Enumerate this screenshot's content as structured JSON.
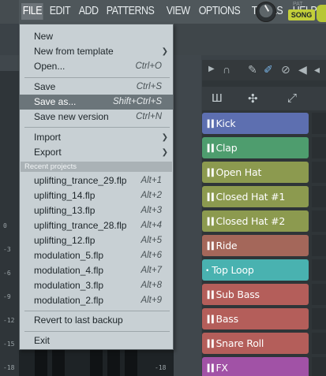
{
  "menubar": {
    "items": [
      "FILE",
      "EDIT",
      "ADD",
      "PATTERNS",
      "VIEW",
      "OPTIONS",
      "TOOLS",
      "HELP"
    ],
    "pattern_label": "PAT",
    "song_label": "SONG"
  },
  "file_menu": {
    "new": "New",
    "new_from_template": "New from template",
    "open": {
      "label": "Open...",
      "shortcut": "Ctrl+O"
    },
    "save": {
      "label": "Save",
      "shortcut": "Ctrl+S"
    },
    "save_as": {
      "label": "Save as...",
      "shortcut": "Shift+Ctrl+S"
    },
    "save_new_version": {
      "label": "Save new version",
      "shortcut": "Ctrl+N"
    },
    "import": "Import",
    "export": "Export",
    "recent_header": "Recent projects",
    "recent": [
      {
        "label": "uplifting_trance_29.flp",
        "shortcut": "Alt+1"
      },
      {
        "label": "uplifting_14.flp",
        "shortcut": "Alt+2"
      },
      {
        "label": "uplifting_13.flp",
        "shortcut": "Alt+3"
      },
      {
        "label": "uplifting_trance_28.flp",
        "shortcut": "Alt+4"
      },
      {
        "label": "uplifting_12.flp",
        "shortcut": "Alt+5"
      },
      {
        "label": "modulation_5.flp",
        "shortcut": "Alt+6"
      },
      {
        "label": "modulation_4.flp",
        "shortcut": "Alt+7"
      },
      {
        "label": "modulation_3.flp",
        "shortcut": "Alt+8"
      },
      {
        "label": "modulation_2.flp",
        "shortcut": "Alt+9"
      }
    ],
    "revert": "Revert to last backup",
    "exit": "Exit"
  },
  "mixer": {
    "db_labels": [
      "0",
      "-3",
      "-6",
      "-9",
      "-12",
      "-15",
      "-18"
    ],
    "db_right": "-18"
  },
  "channels": [
    {
      "name": "Kick",
      "color": "#5d6fb0",
      "mark": "▐▐"
    },
    {
      "name": "Clap",
      "color": "#4e9d6e",
      "mark": "▐▐"
    },
    {
      "name": "Open Hat",
      "color": "#8c9a4f",
      "mark": "▐▐"
    },
    {
      "name": "Closed Hat #1",
      "color": "#8c9a4f",
      "mark": "▐▐"
    },
    {
      "name": "Closed Hat #2",
      "color": "#8c9a4f",
      "mark": "▐▐"
    },
    {
      "name": "Ride",
      "color": "#a4675a",
      "mark": "▐▐"
    },
    {
      "name": "Top Loop",
      "color": "#49b2b0",
      "mark": "•"
    },
    {
      "name": "Sub Bass",
      "color": "#b45e5a",
      "mark": "▐▐"
    },
    {
      "name": "Bass",
      "color": "#b45e5a",
      "mark": "▐▐"
    },
    {
      "name": "Snare Roll",
      "color": "#b45e5a",
      "mark": "▐▐"
    },
    {
      "name": "FX",
      "color": "#a152a6",
      "mark": "▐▐"
    }
  ]
}
